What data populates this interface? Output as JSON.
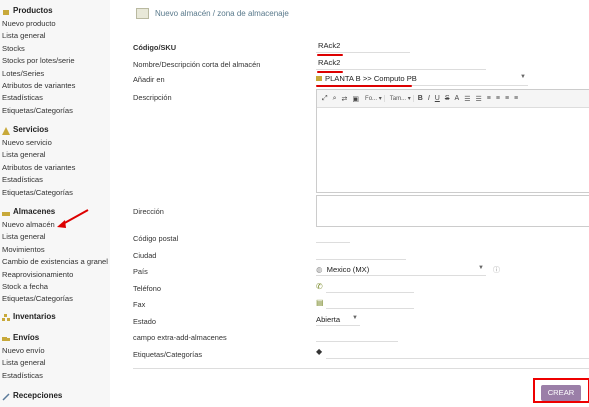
{
  "sidebar": {
    "sections": [
      {
        "title": "Productos",
        "items": [
          "Nuevo producto",
          "Lista general",
          "Stocks",
          "Stocks por lotes/serie",
          "Lotes/Series",
          "Atributos de variantes",
          "Estadísticas",
          "Etiquetas/Categorías"
        ]
      },
      {
        "title": "Servicios",
        "items": [
          "Nuevo servicio",
          "Lista general",
          "Atributos de variantes",
          "Estadísticas",
          "Etiquetas/Categorías"
        ]
      },
      {
        "title": "Almacenes",
        "items": [
          "Nuevo almacén",
          "Lista general",
          "Movimientos",
          "Cambio de existencias a granel",
          "Reaprovisionamiento",
          "Stock a fecha",
          "Etiquetas/Categorías"
        ]
      },
      {
        "title": "Inventarios",
        "items": []
      },
      {
        "title": "Envíos",
        "items": [
          "Nuevo envío",
          "Lista general",
          "Estadísticas"
        ]
      },
      {
        "title": "Recepciones",
        "items": []
      }
    ]
  },
  "page": {
    "title": "Nuevo almacén / zona de almacenaje"
  },
  "form": {
    "codigo_label": "Código/SKU",
    "codigo_value": "RAck2",
    "nombre_label": "Nombre/Descripción corta del almacén",
    "nombre_value": "RAck2",
    "anadir_label": "Añadir en",
    "anadir_value": "PLANTA B >> Computo PB",
    "descripcion_label": "Descripción",
    "editor": {
      "font": "Fo...",
      "size": "Tam..."
    },
    "direccion_label": "Dirección",
    "cp_label": "Código postal",
    "ciudad_label": "Ciudad",
    "pais_label": "País",
    "pais_value": "Mexico (MX)",
    "telefono_label": "Teléfono",
    "fax_label": "Fax",
    "estado_label": "Estado",
    "estado_value": "Abierta",
    "extra_label": "campo extra-add-almacenes",
    "etiquetas_label": "Etiquetas/Categorías",
    "crear_label": "CREAR"
  },
  "colors": {
    "accent": "#9b7fa8",
    "annotation": "#dd0000"
  }
}
